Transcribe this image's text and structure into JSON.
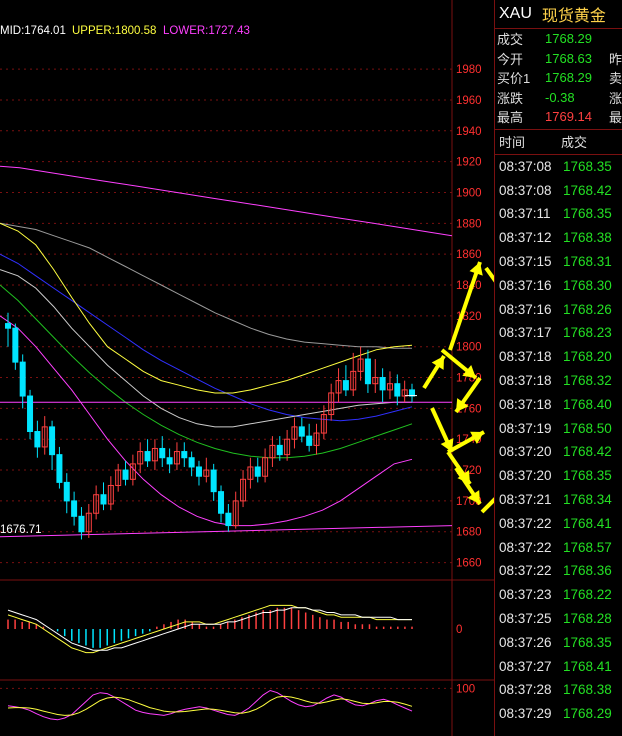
{
  "indicator_header": {
    "mid": "MID:1764.01",
    "upper": "UPPER:1800.58",
    "lower": "LOWER:1727.43"
  },
  "low_marker": "1676.71",
  "colors": {
    "up": "#ff4040",
    "down": "#00e5ff",
    "price": "#23e023",
    "price_up": "#ff4040",
    "axis": "#ff3030",
    "grid": "#7a1010",
    "mid_band": "#cccccc",
    "upper_band": "#ffff40",
    "lower_band": "#ff40ff",
    "ma_blue": "#3030ff",
    "ma_green": "#20c020",
    "arrow": "#ffff00"
  },
  "chart_data": [
    {
      "type": "candlestick",
      "title": "",
      "yticks": [
        1660,
        1680,
        1700,
        1720,
        1740,
        1760,
        1780,
        1800,
        1820,
        1840,
        1860,
        1880,
        1900,
        1920,
        1940,
        1960,
        1980
      ],
      "ylim": [
        1650,
        1995
      ],
      "last_price": 1768.29,
      "candles": [
        [
          1815,
          1812,
          1822,
          1800
        ],
        [
          1812,
          1790,
          1815,
          1785
        ],
        [
          1790,
          1768,
          1795,
          1760
        ],
        [
          1768,
          1745,
          1772,
          1740
        ],
        [
          1745,
          1735,
          1752,
          1728
        ],
        [
          1735,
          1748,
          1755,
          1730
        ],
        [
          1748,
          1730,
          1752,
          1720
        ],
        [
          1730,
          1712,
          1735,
          1708
        ],
        [
          1712,
          1700,
          1718,
          1692
        ],
        [
          1700,
          1690,
          1706,
          1684
        ],
        [
          1690,
          1680,
          1696,
          1675
        ],
        [
          1680,
          1692,
          1698,
          1676
        ],
        [
          1692,
          1704,
          1710,
          1688
        ],
        [
          1704,
          1698,
          1712,
          1694
        ],
        [
          1698,
          1710,
          1716,
          1694
        ],
        [
          1710,
          1720,
          1724,
          1706
        ],
        [
          1720,
          1714,
          1726,
          1710
        ],
        [
          1714,
          1724,
          1730,
          1710
        ],
        [
          1724,
          1732,
          1738,
          1718
        ],
        [
          1732,
          1726,
          1740,
          1722
        ],
        [
          1726,
          1734,
          1740,
          1720
        ],
        [
          1734,
          1728,
          1742,
          1722
        ],
        [
          1728,
          1724,
          1734,
          1718
        ],
        [
          1724,
          1732,
          1738,
          1720
        ],
        [
          1732,
          1728,
          1738,
          1722
        ],
        [
          1728,
          1722,
          1732,
          1716
        ],
        [
          1722,
          1716,
          1726,
          1710
        ],
        [
          1716,
          1720,
          1728,
          1712
        ],
        [
          1720,
          1706,
          1724,
          1700
        ],
        [
          1706,
          1692,
          1710,
          1686
        ],
        [
          1692,
          1684,
          1698,
          1680
        ],
        [
          1684,
          1700,
          1706,
          1682
        ],
        [
          1700,
          1714,
          1720,
          1696
        ],
        [
          1714,
          1722,
          1728,
          1708
        ],
        [
          1722,
          1716,
          1728,
          1712
        ],
        [
          1716,
          1728,
          1734,
          1712
        ],
        [
          1728,
          1736,
          1742,
          1722
        ],
        [
          1736,
          1730,
          1742,
          1726
        ],
        [
          1730,
          1740,
          1746,
          1726
        ],
        [
          1740,
          1748,
          1754,
          1734
        ],
        [
          1748,
          1742,
          1754,
          1738
        ],
        [
          1742,
          1736,
          1750,
          1732
        ],
        [
          1736,
          1744,
          1750,
          1730
        ],
        [
          1744,
          1756,
          1762,
          1740
        ],
        [
          1756,
          1770,
          1776,
          1752
        ],
        [
          1770,
          1778,
          1786,
          1764
        ],
        [
          1778,
          1772,
          1788,
          1768
        ],
        [
          1772,
          1784,
          1796,
          1768
        ],
        [
          1784,
          1792,
          1800,
          1778
        ],
        [
          1792,
          1776,
          1798,
          1770
        ],
        [
          1776,
          1780,
          1792,
          1770
        ],
        [
          1780,
          1772,
          1786,
          1764
        ],
        [
          1772,
          1776,
          1784,
          1766
        ],
        [
          1776,
          1768,
          1782,
          1762
        ],
        [
          1768,
          1772,
          1778,
          1764
        ],
        [
          1772,
          1768,
          1776,
          1764
        ]
      ],
      "upper_band": [
        1880,
        1875,
        1866,
        1850,
        1832,
        1815,
        1800,
        1792,
        1784,
        1778,
        1775,
        1772,
        1770,
        1770,
        1772,
        1775,
        1778,
        1782,
        1786,
        1790,
        1794,
        1798,
        1800,
        1801
      ],
      "mid_band": [
        1850,
        1846,
        1838,
        1826,
        1812,
        1800,
        1788,
        1778,
        1768,
        1760,
        1754,
        1750,
        1748,
        1748,
        1750,
        1752,
        1754,
        1756,
        1758,
        1760,
        1762,
        1763,
        1764,
        1764
      ],
      "lower_band": [
        1820,
        1812,
        1800,
        1786,
        1772,
        1756,
        1740,
        1726,
        1714,
        1704,
        1696,
        1690,
        1686,
        1684,
        1684,
        1685,
        1687,
        1690,
        1694,
        1700,
        1708,
        1716,
        1724,
        1727
      ],
      "ma_long": [
        1917,
        1916,
        1914,
        1912,
        1910,
        1908,
        1906,
        1904,
        1902,
        1900,
        1898,
        1896,
        1894,
        1892,
        1890,
        1888,
        1886,
        1884,
        1882,
        1880,
        1878,
        1876,
        1874,
        1872
      ],
      "ma_mid": [
        1880,
        1878,
        1876,
        1872,
        1868,
        1864,
        1858,
        1852,
        1846,
        1840,
        1834,
        1828,
        1822,
        1817,
        1812,
        1808,
        1805,
        1803,
        1802,
        1801,
        1800,
        1800,
        1799,
        1799
      ],
      "ma_blue": [
        1860,
        1854,
        1846,
        1838,
        1830,
        1822,
        1814,
        1806,
        1798,
        1791,
        1785,
        1779,
        1773,
        1768,
        1763,
        1759,
        1756,
        1754,
        1753,
        1752,
        1753,
        1755,
        1758,
        1761
      ],
      "ma_green": [
        1840,
        1830,
        1818,
        1806,
        1794,
        1783,
        1773,
        1764,
        1756,
        1749,
        1743,
        1738,
        1734,
        1731,
        1729,
        1728,
        1728,
        1729,
        1731,
        1734,
        1738,
        1742,
        1746,
        1750
      ]
    },
    {
      "type": "bar",
      "title": "",
      "yticks": [
        0
      ],
      "ylim": [
        -14,
        14
      ],
      "values": [
        4,
        4,
        3,
        3,
        2,
        1,
        0,
        -1,
        -3,
        -5,
        -6,
        -7,
        -8,
        -8,
        -7,
        -6,
        -5,
        -4,
        -3,
        -2,
        -1,
        1,
        2,
        3,
        4,
        4,
        3,
        2,
        1,
        1,
        2,
        3,
        4,
        5,
        6,
        7,
        8,
        8,
        9,
        9,
        9,
        8,
        7,
        6,
        5,
        4,
        4,
        3,
        3,
        2,
        2,
        2,
        1,
        1,
        1,
        1,
        1,
        1
      ],
      "line_a": [
        6,
        5,
        4,
        3,
        2,
        0,
        -2,
        -4,
        -6,
        -8,
        -9,
        -10,
        -10,
        -9,
        -8,
        -7,
        -6,
        -5,
        -4,
        -3,
        -2,
        -1,
        0,
        1,
        2,
        3,
        3,
        3,
        2,
        2,
        3,
        4,
        5,
        6,
        7,
        8,
        9,
        10,
        10,
        10,
        10,
        9,
        9,
        8,
        7,
        6,
        6,
        5,
        5,
        5,
        5,
        5,
        4,
        4,
        4,
        4,
        4,
        4
      ],
      "line_b": [
        8,
        7,
        6,
        5,
        4,
        2,
        0,
        -2,
        -4,
        -6,
        -7,
        -8,
        -9,
        -9,
        -9,
        -8,
        -8,
        -7,
        -6,
        -5,
        -4,
        -3,
        -2,
        -1,
        0,
        1,
        2,
        2,
        2,
        2,
        2,
        3,
        3,
        4,
        5,
        6,
        7,
        7,
        8,
        8,
        9,
        9,
        9,
        8,
        8,
        7,
        7,
        6,
        6,
        6,
        5,
        5,
        5,
        5,
        5,
        4,
        4,
        4
      ]
    },
    {
      "type": "line",
      "title": "",
      "yticks": [
        100
      ],
      "ylim": [
        0,
        110
      ],
      "k": [
        60,
        58,
        55,
        50,
        42,
        35,
        30,
        28,
        32,
        40,
        55,
        70,
        85,
        90,
        88,
        80,
        70,
        60,
        50,
        45,
        42,
        40,
        38,
        42,
        48,
        52,
        55,
        58,
        55,
        50,
        45,
        40,
        38,
        45,
        55,
        70,
        85,
        95,
        90,
        80,
        70,
        62,
        58,
        60,
        68,
        78,
        85,
        80,
        70,
        62,
        60,
        65,
        72,
        75,
        70,
        62,
        55,
        48
      ],
      "d": [
        55,
        56,
        56,
        55,
        52,
        48,
        44,
        40,
        38,
        39,
        44,
        52,
        62,
        72,
        78,
        80,
        78,
        74,
        68,
        62,
        56,
        52,
        48,
        46,
        46,
        47,
        49,
        51,
        53,
        52,
        50,
        47,
        44,
        43,
        46,
        52,
        61,
        72,
        80,
        82,
        80,
        76,
        71,
        67,
        66,
        69,
        73,
        76,
        74,
        70,
        66,
        65,
        67,
        70,
        70,
        68,
        64,
        59
      ]
    }
  ],
  "quote": {
    "symbol": "XAU",
    "name": "现货黄金",
    "rows": [
      {
        "label": "成交",
        "value": "1768.29",
        "extra": ""
      },
      {
        "label": "今开",
        "value": "1768.63",
        "extra": "昨"
      },
      {
        "label": "买价1",
        "value": "1768.29",
        "extra": "卖"
      },
      {
        "label": "涨跌",
        "value": "-0.38",
        "extra": "涨"
      },
      {
        "label": "最高",
        "value": "1769.14",
        "extra": "最"
      }
    ]
  },
  "ticks_header": {
    "time": "时间",
    "trade": "成交"
  },
  "ticks": [
    {
      "time": "08:37:08",
      "price": "1768.35"
    },
    {
      "time": "08:37:08",
      "price": "1768.42"
    },
    {
      "time": "08:37:11",
      "price": "1768.35"
    },
    {
      "time": "08:37:12",
      "price": "1768.38"
    },
    {
      "time": "08:37:15",
      "price": "1768.31"
    },
    {
      "time": "08:37:16",
      "price": "1768.30"
    },
    {
      "time": "08:37:16",
      "price": "1768.26"
    },
    {
      "time": "08:37:17",
      "price": "1768.23"
    },
    {
      "time": "08:37:18",
      "price": "1768.20"
    },
    {
      "time": "08:37:18",
      "price": "1768.32"
    },
    {
      "time": "08:37:18",
      "price": "1768.40"
    },
    {
      "time": "08:37:19",
      "price": "1768.50"
    },
    {
      "time": "08:37:20",
      "price": "1768.42"
    },
    {
      "time": "08:37:20",
      "price": "1768.35"
    },
    {
      "time": "08:37:21",
      "price": "1768.34"
    },
    {
      "time": "08:37:22",
      "price": "1768.41"
    },
    {
      "time": "08:37:22",
      "price": "1768.57"
    },
    {
      "time": "08:37:22",
      "price": "1768.36"
    },
    {
      "time": "08:37:23",
      "price": "1768.22"
    },
    {
      "time": "08:37:25",
      "price": "1768.28"
    },
    {
      "time": "08:37:26",
      "price": "1768.35"
    },
    {
      "time": "08:37:27",
      "price": "1768.41"
    },
    {
      "time": "08:37:28",
      "price": "1768.38"
    },
    {
      "time": "08:37:29",
      "price": "1768.29"
    }
  ]
}
